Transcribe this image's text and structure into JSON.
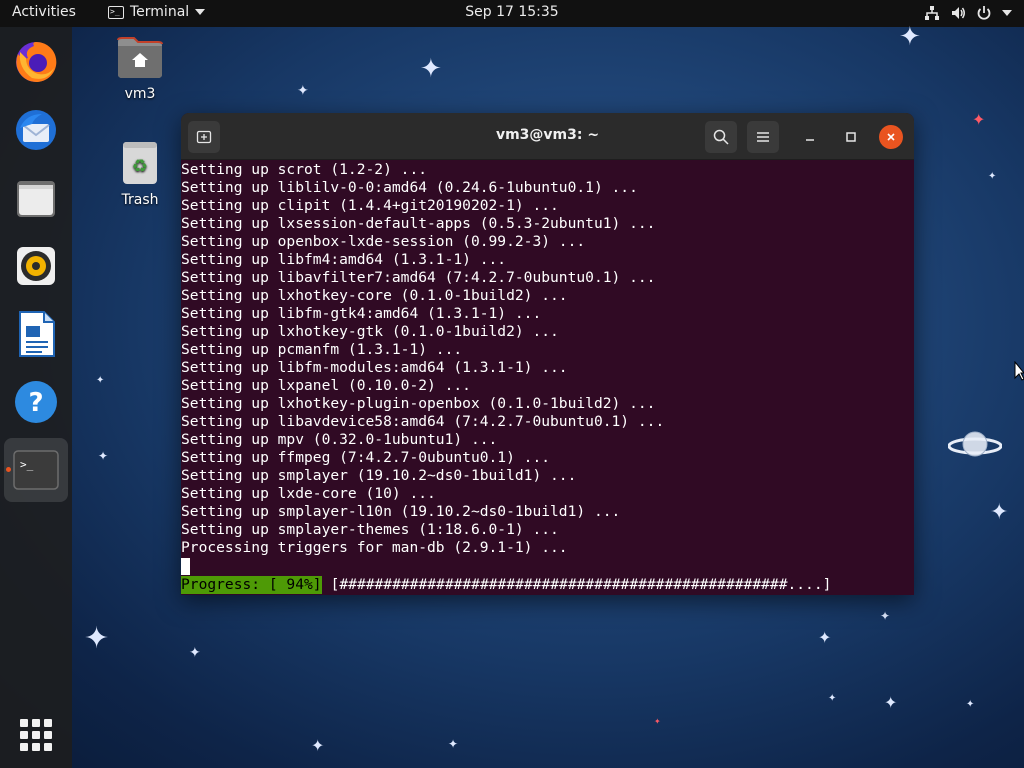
{
  "topbar": {
    "activities": "Activities",
    "app_name": "Terminal",
    "clock": "Sep 17  15:35"
  },
  "dock": {
    "items": [
      "firefox-icon",
      "thunderbird-icon",
      "files-icon",
      "rhythmbox-icon",
      "libreoffice-writer-icon",
      "help-icon",
      "terminal-icon"
    ],
    "active_item": "terminal-icon",
    "terminal_glyph": ">_"
  },
  "desktop": {
    "home_label": "vm3",
    "trash_label": "Trash"
  },
  "terminal": {
    "title": "vm3@vm3: ~",
    "lines": [
      "Setting up scrot (1.2-2) ...",
      "Setting up liblilv-0-0:amd64 (0.24.6-1ubuntu0.1) ...",
      "Setting up clipit (1.4.4+git20190202-1) ...",
      "Setting up lxsession-default-apps (0.5.3-2ubuntu1) ...",
      "Setting up openbox-lxde-session (0.99.2-3) ...",
      "Setting up libfm4:amd64 (1.3.1-1) ...",
      "Setting up libavfilter7:amd64 (7:4.2.7-0ubuntu0.1) ...",
      "Setting up lxhotkey-core (0.1.0-1build2) ...",
      "Setting up libfm-gtk4:amd64 (1.3.1-1) ...",
      "Setting up lxhotkey-gtk (0.1.0-1build2) ...",
      "Setting up pcmanfm (1.3.1-1) ...",
      "Setting up libfm-modules:amd64 (1.3.1-1) ...",
      "Setting up lxpanel (0.10.0-2) ...",
      "Setting up lxhotkey-plugin-openbox (0.1.0-1build2) ...",
      "Setting up libavdevice58:amd64 (7:4.2.7-0ubuntu0.1) ...",
      "Setting up mpv (0.32.0-1ubuntu1) ...",
      "Setting up ffmpeg (7:4.2.7-0ubuntu0.1) ...",
      "Setting up smplayer (19.10.2~ds0-1build1) ...",
      "Setting up lxde-core (10) ...",
      "Setting up smplayer-l10n (19.10.2~ds0-1build1) ...",
      "Setting up smplayer-themes (1:18.6.0-1) ...",
      "Processing triggers for man-db (2.9.1-1) ..."
    ],
    "progress_label": "Progress: [ 94%]",
    "progress_bar": "[###################################################....]",
    "progress_percent": 94
  },
  "colors": {
    "terminal_bg": "#300a24",
    "progress_bg": "#4e9a06",
    "accent": "#e95420",
    "titlebar": "#2b2b2b"
  }
}
